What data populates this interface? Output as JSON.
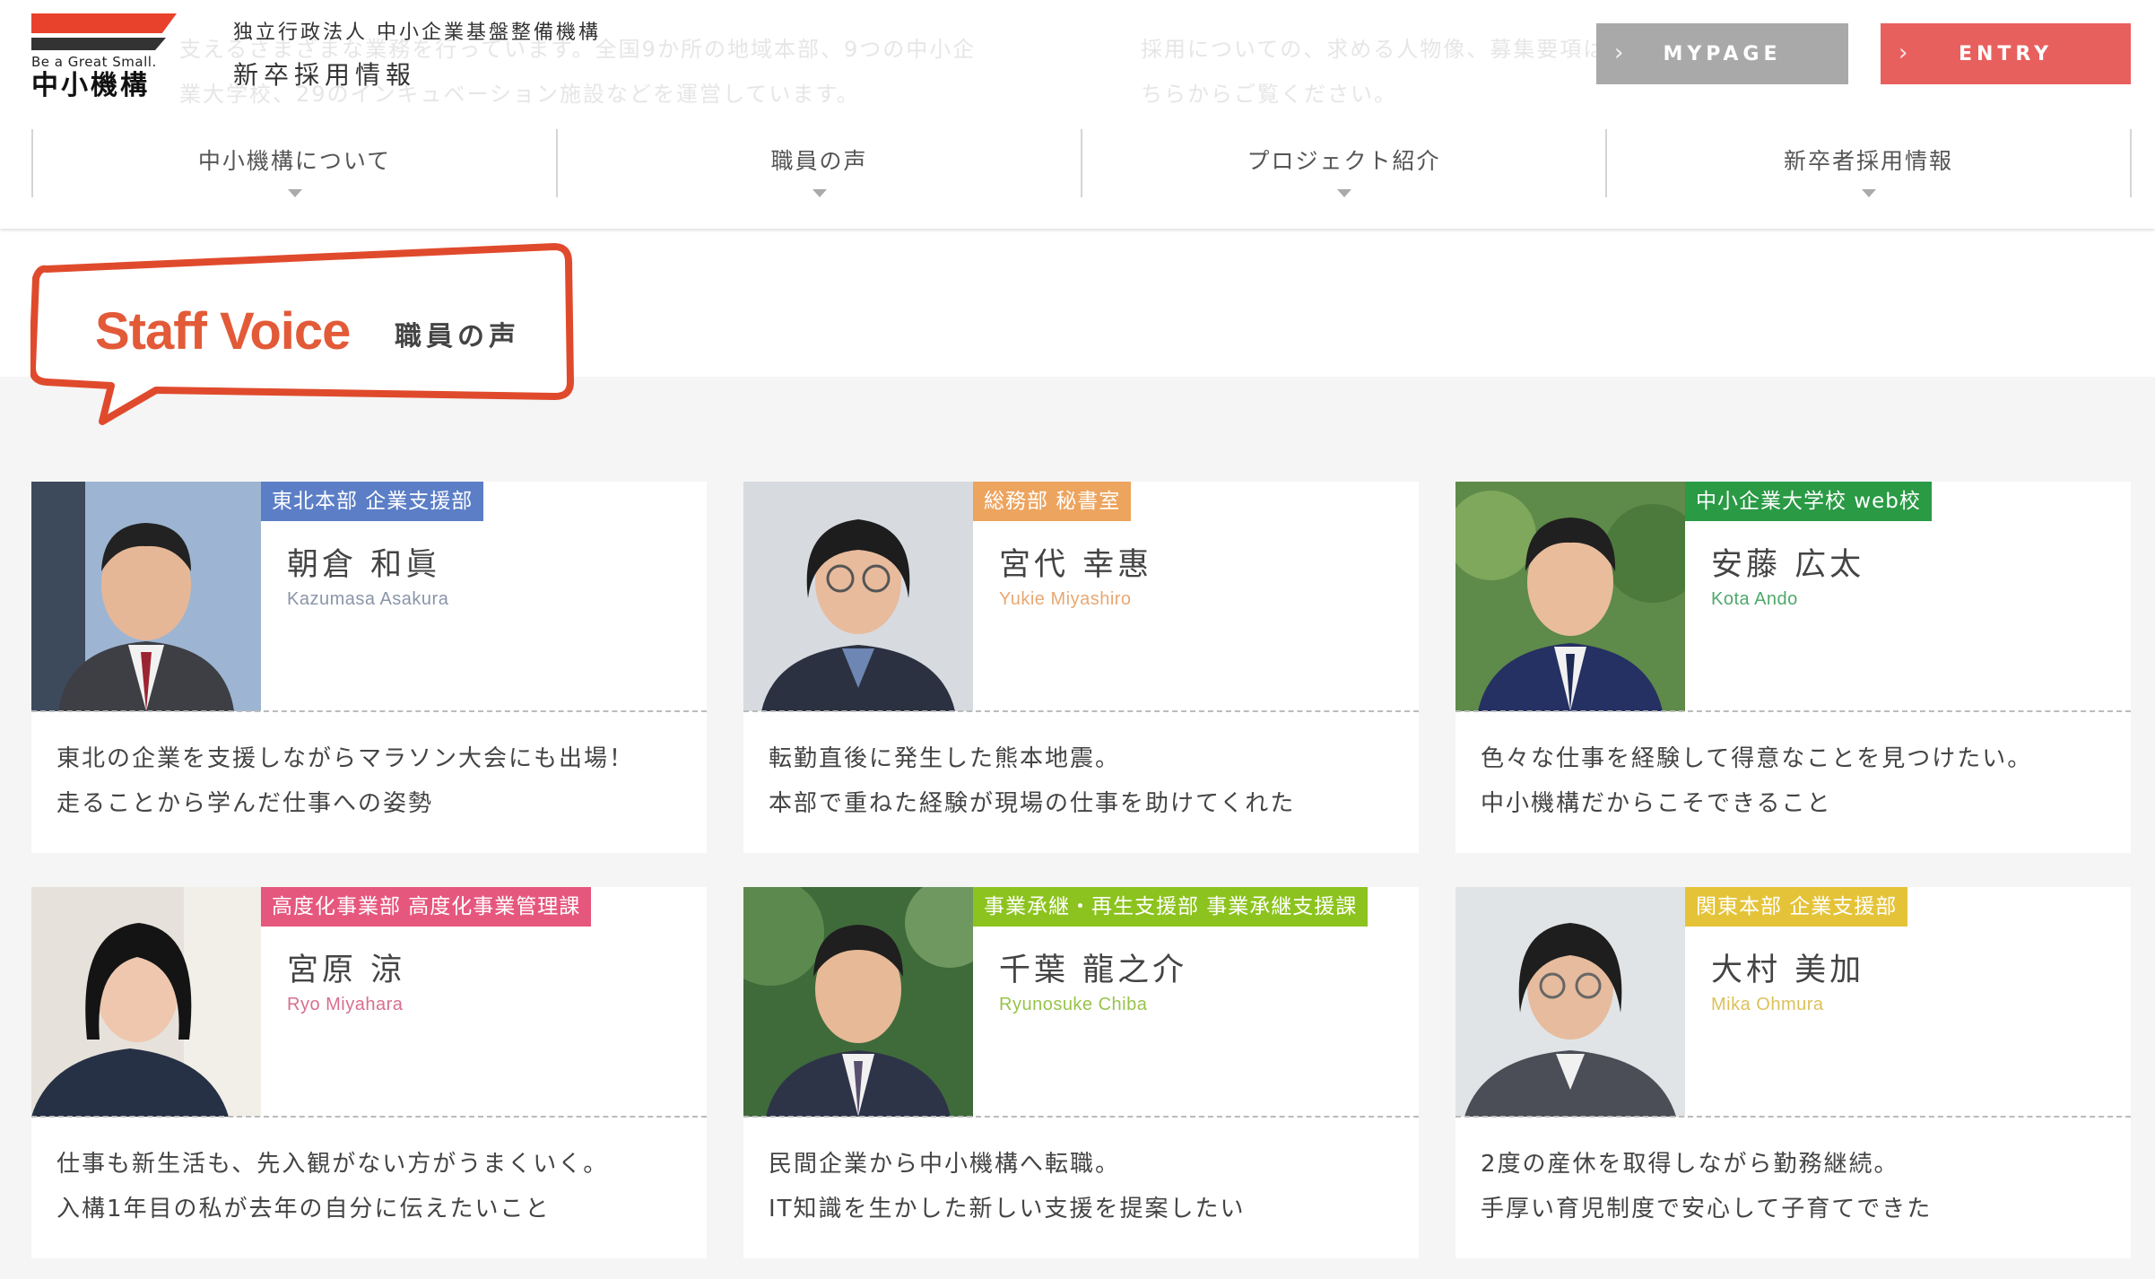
{
  "header": {
    "ghost_text_left": "支えるさまざまな業務を行っています。全国9か所の地域本部、9つの中小企\n業大学校、29のインキュベーション施設などを運営しています。",
    "ghost_text_right": "採用についての、求める人物像、募集要項はこ\nちらからご覧ください。",
    "logo_tagline": "Be a Great Small.",
    "logo_name": "中小機構",
    "org_name": "独立行政法人 中小企業基盤整備機構",
    "site_title": "新卒採用情報",
    "mypage_label": "MYPAGE",
    "entry_label": "ENTRY",
    "arrow": "›"
  },
  "nav": {
    "items": [
      {
        "label": "中小機構について"
      },
      {
        "label": "職員の声"
      },
      {
        "label": "プロジェクト紹介"
      },
      {
        "label": "新卒者採用情報"
      }
    ]
  },
  "section": {
    "title": "Staff Voice",
    "subtitle": "職員の声"
  },
  "staff": [
    {
      "dept": "東北本部 企業支援部",
      "dept_color": "#5b7ec6",
      "name_jp": "朝倉 和眞",
      "name_en": "Kazumasa Asakura",
      "en_color": "#8a95a8",
      "line1": "東北の企業を支援しながらマラソン大会にも出場！",
      "line2": "走ることから学んだ仕事への姿勢"
    },
    {
      "dept": "総務部 秘書室",
      "dept_color": "#eda45e",
      "name_jp": "宮代 幸惠",
      "name_en": "Yukie Miyashiro",
      "en_color": "#e8a873",
      "line1": "転勤直後に発生した熊本地震。",
      "line2": "本部で重ねた経験が現場の仕事を助けてくれた"
    },
    {
      "dept": "中小企業大学校 web校",
      "dept_color": "#2a9a45",
      "name_jp": "安藤 広太",
      "name_en": "Kota Ando",
      "en_color": "#4fa86a",
      "line1": "色々な仕事を経験して得意なことを見つけたい。",
      "line2": "中小機構だからこそできること"
    },
    {
      "dept": "高度化事業部 高度化事業管理課",
      "dept_color": "#e6577e",
      "name_jp": "宮原 涼",
      "name_en": "Ryo Miyahara",
      "en_color": "#d86f8d",
      "line1": "仕事も新生活も、先入観がない方がうまくいく。",
      "line2": "入構1年目の私が去年の自分に伝えたいこと"
    },
    {
      "dept": "事業承継・再生支援部 事業承継支援課",
      "dept_color": "#8cc31e",
      "name_jp": "千葉 龍之介",
      "name_en": "Ryunosuke Chiba",
      "en_color": "#98c34a",
      "line1": "民間企業から中小機構へ転職。",
      "line2": "IT知識を生かした新しい支援を提案したい"
    },
    {
      "dept": "関東本部 企業支援部",
      "dept_color": "#e5c338",
      "name_jp": "大村 美加",
      "name_en": "Mika Ohmura",
      "en_color": "#dcc15a",
      "line1": "2度の産休を取得しながら勤務継続。",
      "line2": "手厚い育児制度で安心して子育てできた"
    }
  ]
}
